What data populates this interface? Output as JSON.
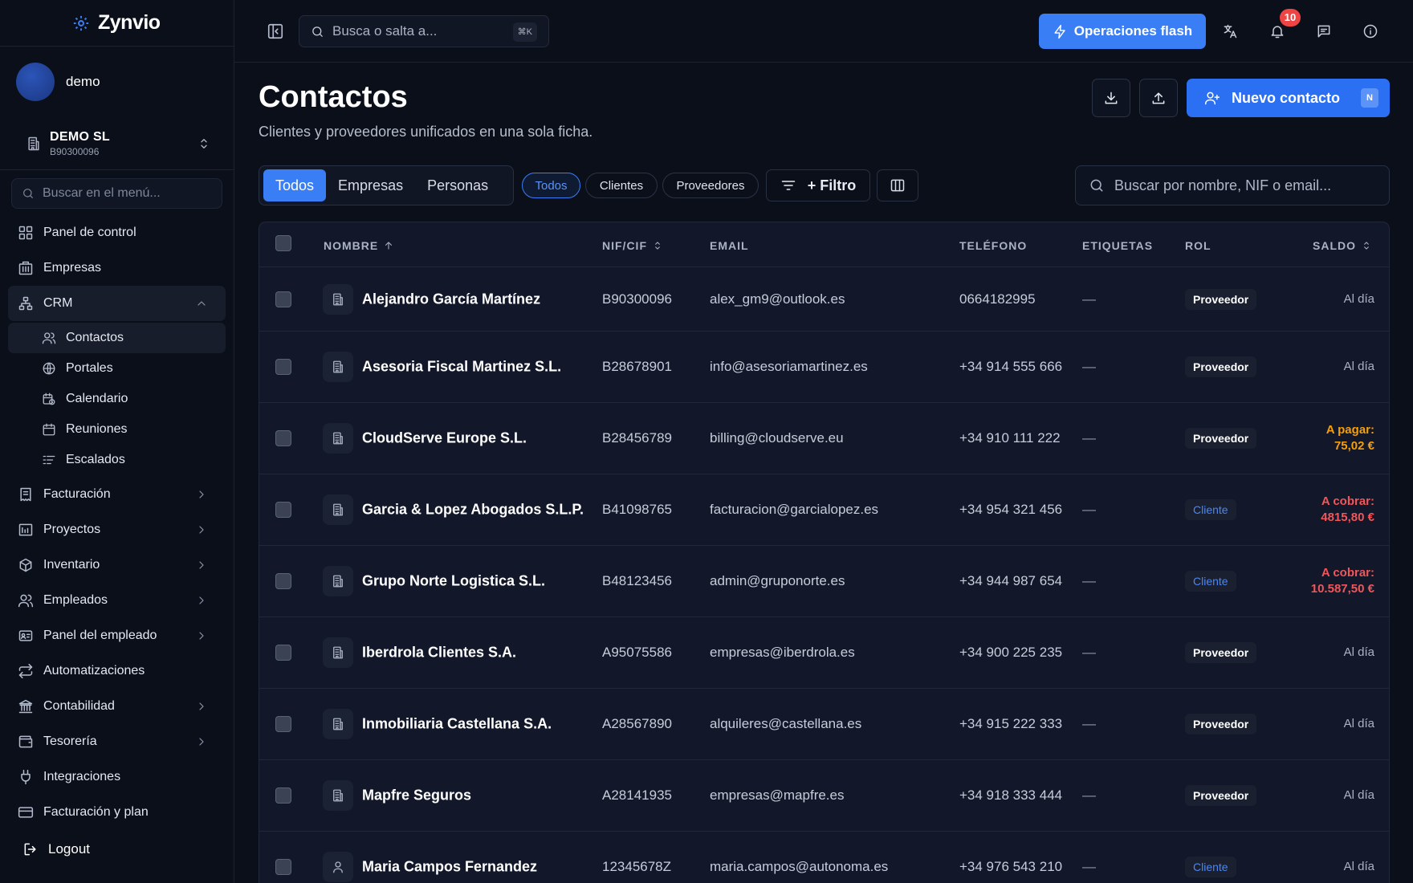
{
  "app": {
    "name": "Zynvio"
  },
  "user": {
    "name": "demo"
  },
  "company": {
    "name": "DEMO SL",
    "id": "B90300096"
  },
  "sidebar": {
    "search_placeholder": "Buscar en el menú...",
    "items": [
      {
        "label": "Panel de control",
        "icon": "dashboard-icon"
      },
      {
        "label": "Empresas",
        "icon": "building-icon"
      },
      {
        "label": "CRM",
        "icon": "network-icon"
      },
      {
        "label": "Facturación",
        "icon": "invoice-icon"
      },
      {
        "label": "Proyectos",
        "icon": "projects-icon"
      },
      {
        "label": "Inventario",
        "icon": "box-icon"
      },
      {
        "label": "Empleados",
        "icon": "users-icon"
      },
      {
        "label": "Panel del empleado",
        "icon": "id-card-icon"
      },
      {
        "label": "Automatizaciones",
        "icon": "repeat-icon"
      },
      {
        "label": "Contabilidad",
        "icon": "bank-icon"
      },
      {
        "label": "Tesorería",
        "icon": "wallet-icon"
      },
      {
        "label": "Integraciones",
        "icon": "plug-icon"
      },
      {
        "label": "Facturación y plan",
        "icon": "credit-card-icon"
      }
    ],
    "crm_sub": [
      {
        "label": "Contactos",
        "icon": "contacts-icon"
      },
      {
        "label": "Portales",
        "icon": "globe-icon"
      },
      {
        "label": "Calendario",
        "icon": "calendar-clock-icon"
      },
      {
        "label": "Reuniones",
        "icon": "calendar-icon"
      },
      {
        "label": "Escalados",
        "icon": "list-icon"
      }
    ],
    "logout": "Logout"
  },
  "topbar": {
    "search_placeholder": "Busca o salta a...",
    "shortcut": "⌘K",
    "flash_label": "Operaciones flash",
    "notifications_count": "10"
  },
  "page": {
    "title": "Contactos",
    "subtitle": "Clientes y proveedores unificados en una sola ficha.",
    "new_label": "Nuevo contacto",
    "new_shortcut": "N"
  },
  "filters": {
    "type_tabs": [
      "Todos",
      "Empresas",
      "Personas"
    ],
    "role_pills": [
      "Todos",
      "Clientes",
      "Proveedores"
    ],
    "filter_label": "+ Filtro",
    "search_placeholder": "Buscar por nombre, NIF o email..."
  },
  "table": {
    "headers": {
      "name": "NOMBRE",
      "nif": "NIF/CIF",
      "email": "EMAIL",
      "phone": "TELÉFONO",
      "tags": "ETIQUETAS",
      "role": "ROL",
      "balance": "SALDO"
    },
    "rows": [
      {
        "name": "Alejandro García Martínez",
        "type": "company",
        "nif": "B90300096",
        "email": "alex_gm9@outlook.es",
        "phone": "0664182995",
        "tags": "—",
        "role": "Proveedor",
        "balance_label": "",
        "balance": "Al día"
      },
      {
        "name": "Asesoria Fiscal Martinez S.L.",
        "type": "company",
        "nif": "B28678901",
        "email": "info@asesoriamartinez.es",
        "phone": "+34 914 555 666",
        "tags": "—",
        "role": "Proveedor",
        "balance_label": "",
        "balance": "Al día"
      },
      {
        "name": "CloudServe Europe S.L.",
        "type": "company",
        "nif": "B28456789",
        "email": "billing@cloudserve.eu",
        "phone": "+34 910 111 222",
        "tags": "—",
        "role": "Proveedor",
        "balance_label": "A pagar:",
        "balance": "75,02 €"
      },
      {
        "name": "Garcia & Lopez Abogados S.L.P.",
        "type": "company",
        "nif": "B41098765",
        "email": "facturacion@garcialopez.es",
        "phone": "+34 954 321 456",
        "tags": "—",
        "role": "Cliente",
        "balance_label": "A cobrar:",
        "balance": "4815,80 €"
      },
      {
        "name": "Grupo Norte Logistica S.L.",
        "type": "company",
        "nif": "B48123456",
        "email": "admin@gruponorte.es",
        "phone": "+34 944 987 654",
        "tags": "—",
        "role": "Cliente",
        "balance_label": "A cobrar:",
        "balance": "10.587,50 €"
      },
      {
        "name": "Iberdrola Clientes S.A.",
        "type": "company",
        "nif": "A95075586",
        "email": "empresas@iberdrola.es",
        "phone": "+34 900 225 235",
        "tags": "—",
        "role": "Proveedor",
        "balance_label": "",
        "balance": "Al día"
      },
      {
        "name": "Inmobiliaria Castellana S.A.",
        "type": "company",
        "nif": "A28567890",
        "email": "alquileres@castellana.es",
        "phone": "+34 915 222 333",
        "tags": "—",
        "role": "Proveedor",
        "balance_label": "",
        "balance": "Al día"
      },
      {
        "name": "Mapfre Seguros",
        "type": "company",
        "nif": "A28141935",
        "email": "empresas@mapfre.es",
        "phone": "+34 918 333 444",
        "tags": "—",
        "role": "Proveedor",
        "balance_label": "",
        "balance": "Al día"
      },
      {
        "name": "Maria Campos Fernandez",
        "type": "person",
        "nif": "12345678Z",
        "email": "maria.campos@autonoma.es",
        "phone": "+34 976 543 210",
        "tags": "—",
        "role": "Cliente",
        "balance_label": "",
        "balance": "Al día"
      }
    ]
  }
}
